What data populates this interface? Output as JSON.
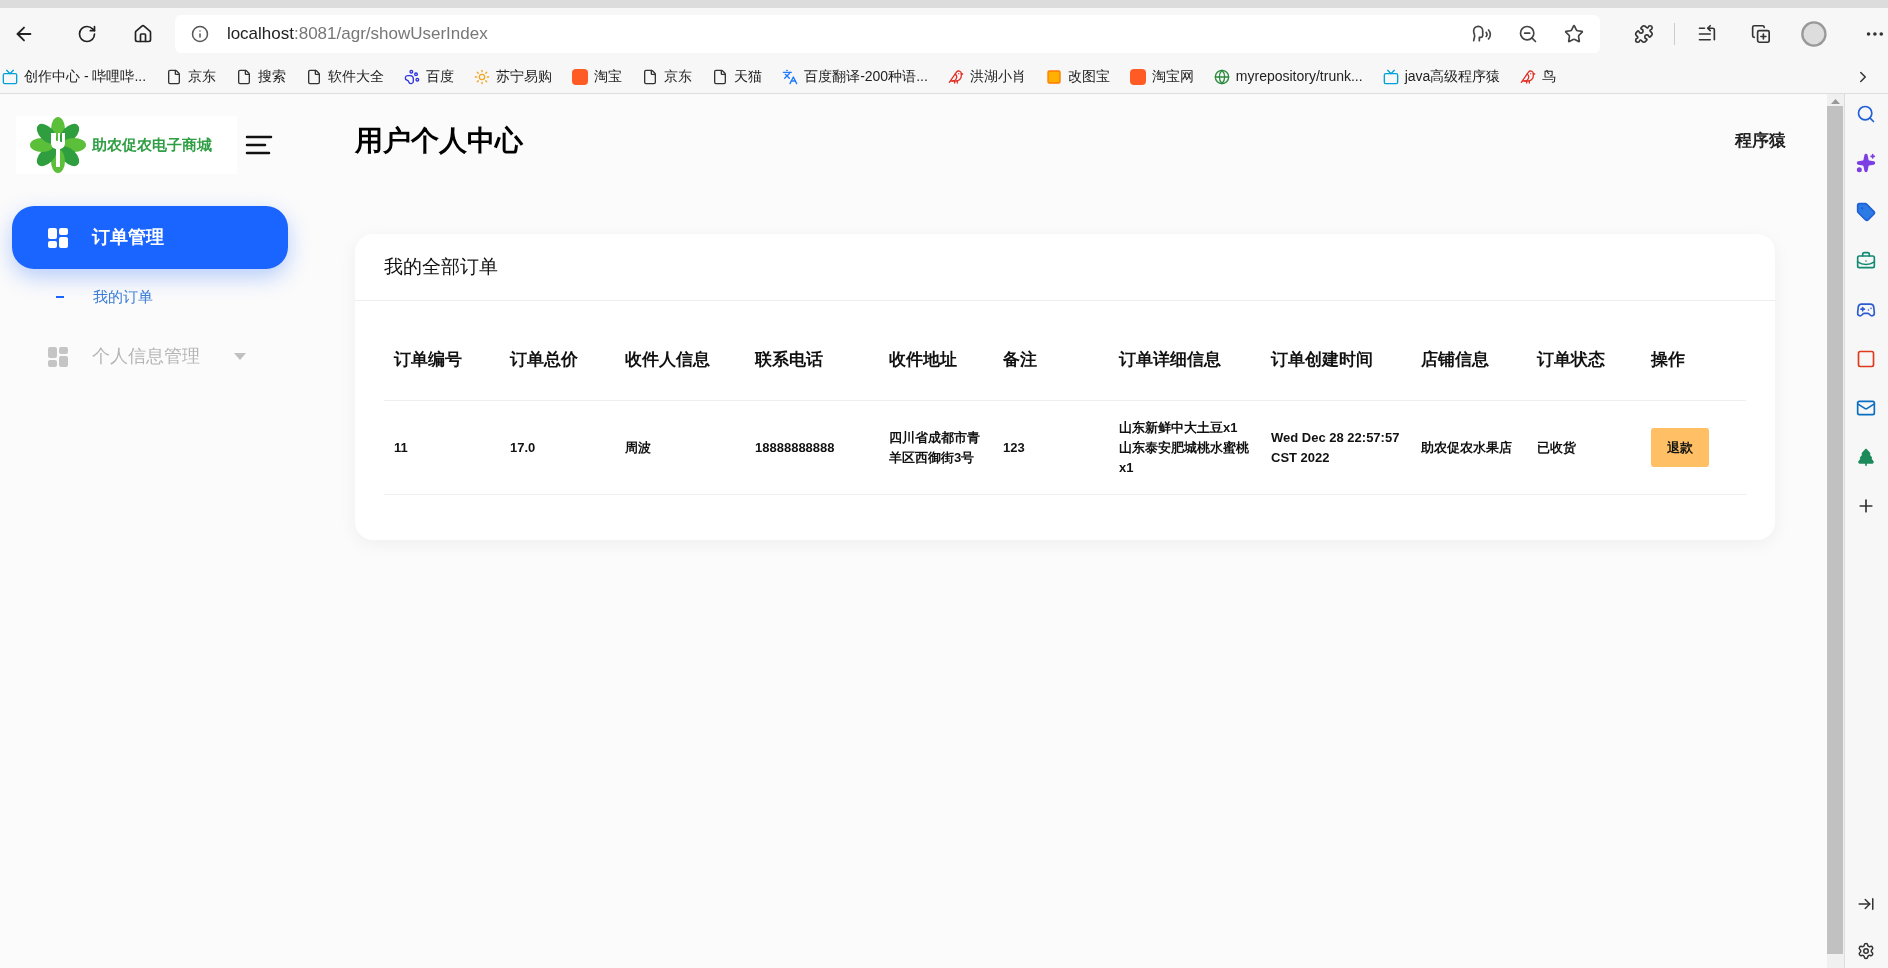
{
  "browser": {
    "address": {
      "host": "localhost",
      "path": ":8081/agr/showUserIndex"
    },
    "bookmarks": [
      {
        "label": "创作中心 - 哔哩哔...",
        "kind": "tv"
      },
      {
        "label": "京东",
        "kind": "page"
      },
      {
        "label": "搜索",
        "kind": "page"
      },
      {
        "label": "软件大全",
        "kind": "page"
      },
      {
        "label": "百度",
        "kind": "paw"
      },
      {
        "label": "苏宁易购",
        "kind": "lion"
      },
      {
        "label": "淘宝",
        "kind": "tao"
      },
      {
        "label": "京东",
        "kind": "page"
      },
      {
        "label": "天猫",
        "kind": "page"
      },
      {
        "label": "百度翻译-200种语...",
        "kind": "translate"
      },
      {
        "label": "洪湖小肖",
        "kind": "bird"
      },
      {
        "label": "改图宝",
        "kind": "square"
      },
      {
        "label": "淘宝网",
        "kind": "tao"
      },
      {
        "label": "myrepository/trunk...",
        "kind": "globe"
      },
      {
        "label": "java高级程序猿",
        "kind": "tv"
      },
      {
        "label": "鸟",
        "kind": "bird"
      }
    ]
  },
  "brand": {
    "name": "助农促农电子商城"
  },
  "menu": [
    {
      "label": "订单管理",
      "selected": true,
      "expanded": true,
      "children": [
        {
          "label": "我的订单",
          "selected": false
        }
      ]
    },
    {
      "label": "个人信息管理",
      "selected": false,
      "expanded": false
    }
  ],
  "header": {
    "title": "用户个人中心",
    "user": "程序猿"
  },
  "card": {
    "title": "我的全部订单",
    "table": {
      "columns": [
        "订单编号",
        "订单总价",
        "收件人信息",
        "联系电话",
        "收件地址",
        "备注",
        "订单详细信息",
        "订单创建时间",
        "店铺信息",
        "订单状态",
        "操作"
      ],
      "rows": [
        {
          "cells": [
            "11",
            "17.0",
            "周波",
            "18888888888",
            "四川省成都市青羊区西御街3号",
            "123",
            "山东新鲜中大土豆x1 山东泰安肥城桃水蜜桃x1",
            "Wed Dec 28 22:57:57 CST 2022",
            "助农促农水果店",
            "已收货"
          ],
          "action": "退款"
        }
      ]
    }
  }
}
